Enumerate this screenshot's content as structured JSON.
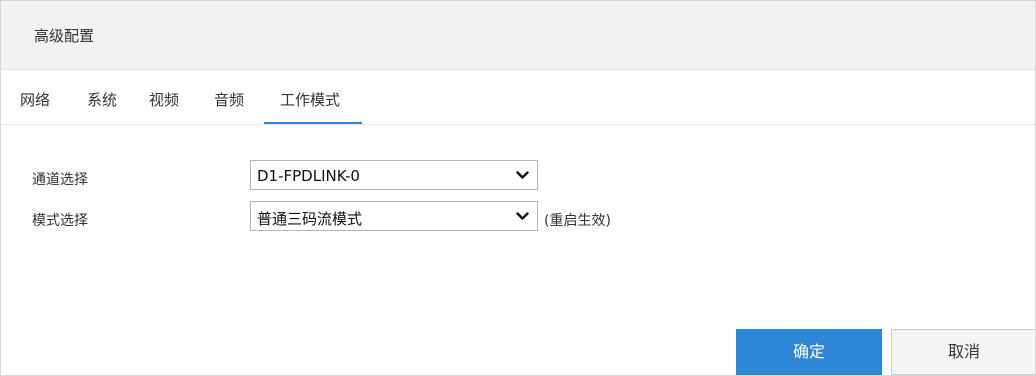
{
  "header": {
    "title": "高级配置"
  },
  "tabs": [
    {
      "label": "网络"
    },
    {
      "label": "系统"
    },
    {
      "label": "视频"
    },
    {
      "label": "音频"
    },
    {
      "label": "工作模式",
      "active": true
    }
  ],
  "form": {
    "channel": {
      "label": "通道选择",
      "value": "D1-FPDLINK-0"
    },
    "mode": {
      "label": "模式选择",
      "value": "普通三码流模式",
      "hint": "(重启生效)"
    }
  },
  "buttons": {
    "confirm_label": "确定",
    "cancel_label": "取消"
  },
  "colors": {
    "accent": "#2d87d6",
    "header_bg": "#f2f2f2"
  }
}
